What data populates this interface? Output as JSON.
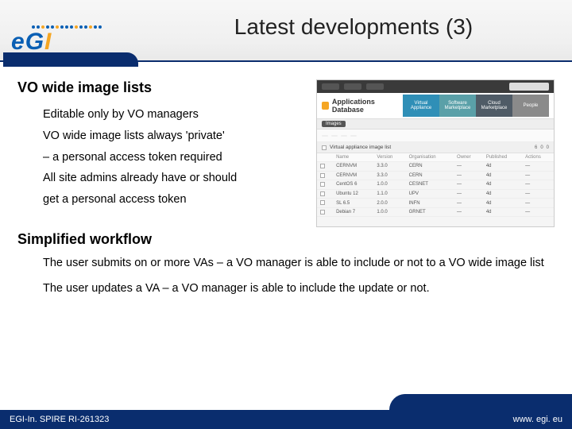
{
  "logo": {
    "text_e": "e",
    "text_g": "G",
    "text_i": "I"
  },
  "title": "Latest developments (3)",
  "section1": {
    "heading": "VO wide image lists",
    "lines": [
      "Editable only by VO managers",
      "VO wide image lists always 'private'",
      "– a personal access token required",
      "All site admins already have or should",
      "get a personal access token"
    ]
  },
  "section2": {
    "heading": "Simplified workflow",
    "paras": [
      "The user submits on or more VAs – a VO manager is able to include or not to a VO wide image list",
      "The user updates a VA – a VO manager is able to include the update or not."
    ]
  },
  "footer": {
    "left": "EGI-In. SPIRE RI-261323",
    "right": "www. egi. eu"
  },
  "shot": {
    "brand": "Applications Database",
    "tiles": [
      "Virtual Appliance",
      "Software Marketplace",
      "Cloud Marketplace",
      "People"
    ],
    "tab": "Images",
    "listname": "Virtual appliance image list",
    "counts": {
      "items": "6",
      "removed": "0",
      "updated": "0"
    },
    "cols": [
      "",
      "Name",
      "Version",
      "Organisation",
      "Owner",
      "Published",
      "Actions"
    ],
    "rows": [
      [
        "",
        "CERNVM",
        "3.3.0",
        "CERN",
        "—",
        "4d",
        "—"
      ],
      [
        "",
        "CERNVM",
        "3.3.0",
        "CERN",
        "—",
        "4d",
        "—"
      ],
      [
        "",
        "CentOS 6",
        "1.0.0",
        "CESNET",
        "—",
        "4d",
        "—"
      ],
      [
        "",
        "Ubuntu 12",
        "1.1.0",
        "UPV",
        "—",
        "4d",
        "—"
      ],
      [
        "",
        "SL 6.5",
        "2.0.0",
        "INFN",
        "—",
        "4d",
        "—"
      ],
      [
        "",
        "Debian 7",
        "1.0.0",
        "GRNET",
        "—",
        "4d",
        "—"
      ]
    ]
  }
}
